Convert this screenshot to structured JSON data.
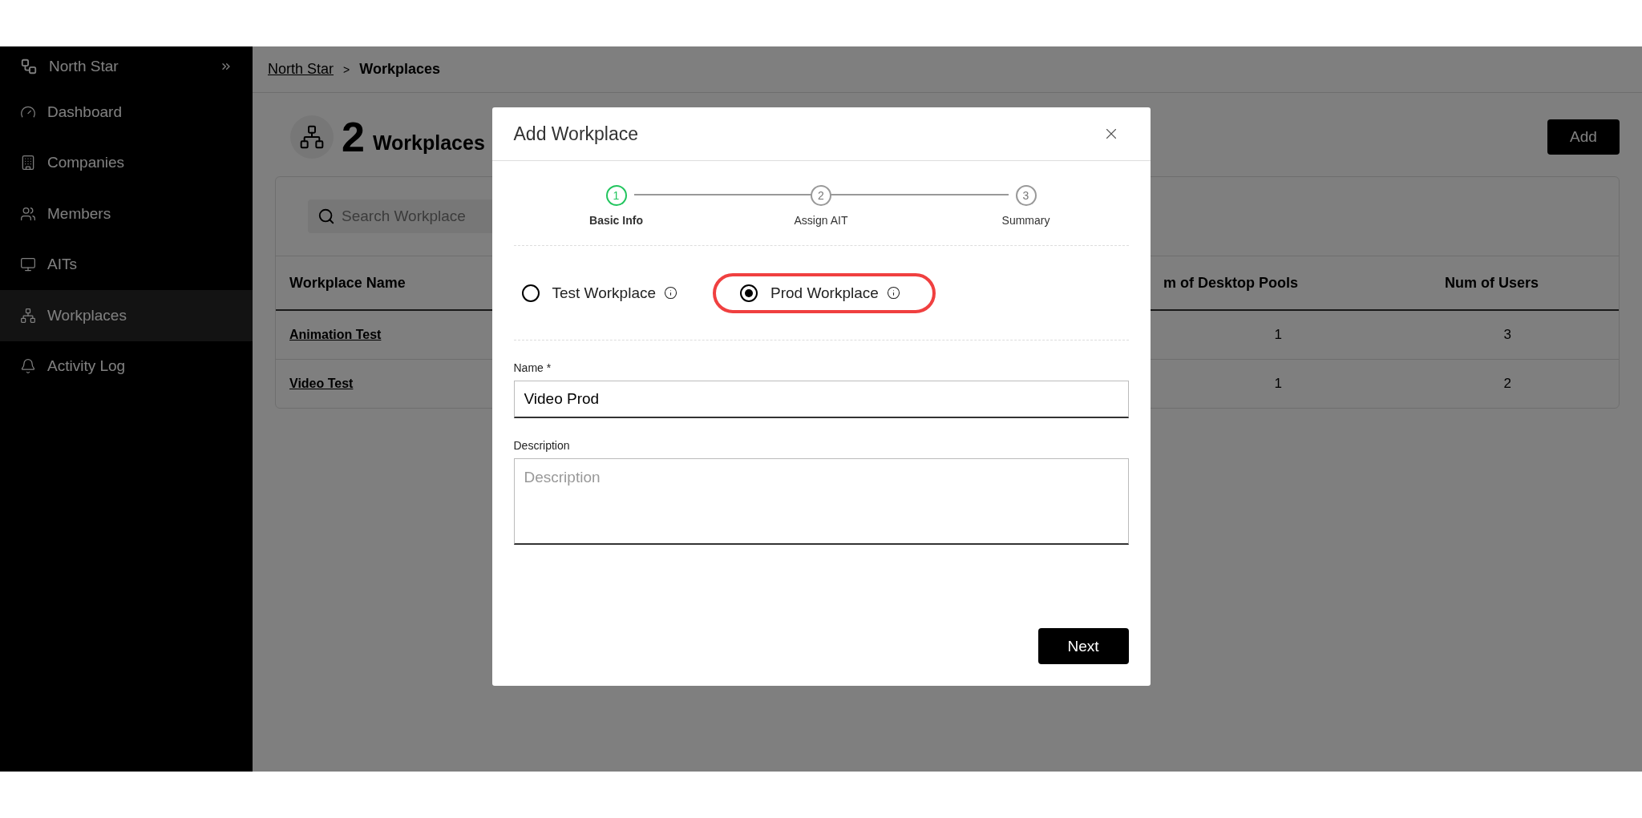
{
  "sidebar": {
    "brand": "North Star",
    "items": [
      {
        "label": "Dashboard",
        "selected": false
      },
      {
        "label": "Companies",
        "selected": false
      },
      {
        "label": "Members",
        "selected": false
      },
      {
        "label": "AITs",
        "selected": false
      },
      {
        "label": "Workplaces",
        "selected": true
      },
      {
        "label": "Activity Log",
        "selected": false
      }
    ]
  },
  "breadcrumb": {
    "items": [
      "North Star",
      "Workplaces"
    ],
    "separator": ">"
  },
  "header": {
    "count": "2",
    "title": "Workplaces",
    "add_button": "Add"
  },
  "search": {
    "placeholder": "Search Workplace"
  },
  "table": {
    "columns": [
      "Workplace Name",
      "m of Desktop Pools",
      "Num of Users"
    ],
    "rows": [
      {
        "name": "Animation Test",
        "column_2": "1",
        "users": "3"
      },
      {
        "name": "Video Test",
        "column_2": "1",
        "users": "2"
      }
    ]
  },
  "modal": {
    "title": "Add Workplace",
    "steps": [
      {
        "number": "1",
        "label": "Basic Info",
        "selected": true
      },
      {
        "number": "2",
        "label": "Assign AIT",
        "selected": false
      },
      {
        "number": "3",
        "label": "Summary",
        "selected": false
      }
    ],
    "options": [
      {
        "label": "Test Workplace",
        "selected": false,
        "highlighted": false
      },
      {
        "label": "Prod Workplace",
        "selected": true,
        "highlighted": true
      }
    ],
    "name": {
      "label": "Name *",
      "value": "Video Prod"
    },
    "description": {
      "label": "Description",
      "placeholder": "Description"
    },
    "next_button": "Next"
  }
}
